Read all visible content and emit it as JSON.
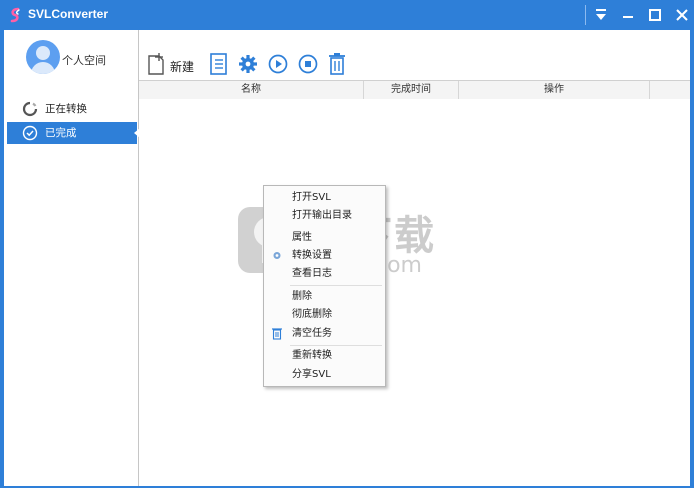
{
  "window": {
    "title": "SVLConverter",
    "accent": "#2e7fd8"
  },
  "window_controls": {
    "menu_icon": "dropdown-menu-icon",
    "minimize_icon": "minimize-icon",
    "maximize_icon": "maximize-icon",
    "close_icon": "close-icon"
  },
  "sidebar": {
    "user_label": "个人空间",
    "items": [
      {
        "label": "正在转换",
        "icon": "converting-spinner-icon",
        "active": false
      },
      {
        "label": "已完成",
        "icon": "check-circle-icon",
        "active": true
      }
    ]
  },
  "toolbar": {
    "new_label": "新建",
    "icons": [
      "new-file-icon",
      "document-list-icon",
      "settings-gear-icon",
      "play-icon",
      "stop-icon",
      "trash-icon"
    ]
  },
  "table": {
    "columns": [
      "名称",
      "完成时间",
      "操作"
    ],
    "rows": []
  },
  "context_menu": {
    "groups": [
      [
        "打开SVL",
        "打开输出目录",
        "属性",
        "转换设置",
        "查看日志"
      ],
      [
        "删除",
        "彻底删除",
        "清空任务"
      ],
      [
        "重新转换",
        "分享SVL"
      ]
    ]
  },
  "watermark": {
    "text": "安下载",
    "domain": "anxz.com"
  }
}
